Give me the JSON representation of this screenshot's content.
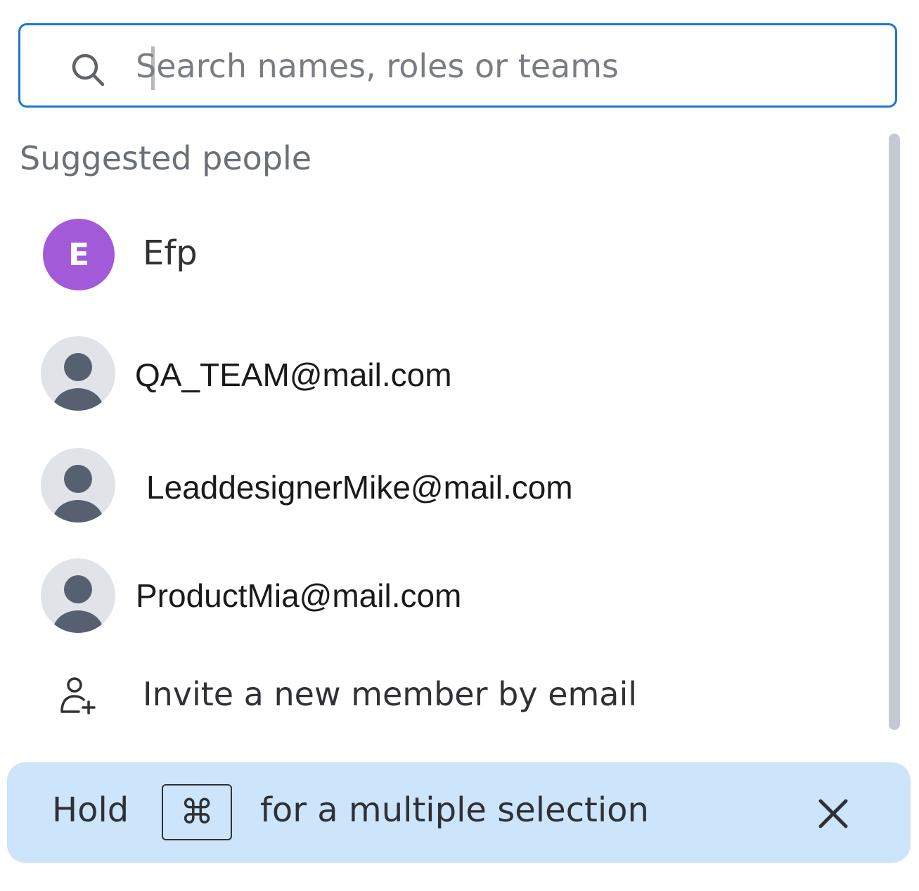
{
  "search": {
    "placeholder": "Search names, roles or teams",
    "value": "",
    "icon": "search-icon",
    "border_color": "#1f76d2"
  },
  "section": {
    "title": "Suggested people"
  },
  "people": [
    {
      "initial": "E",
      "name": "Efp",
      "avatar": "letter",
      "avatar_color": "#a25ad9"
    },
    {
      "name": "QA_TEAM@mail.com",
      "avatar": "generic-person-icon"
    },
    {
      "name": "LeaddesignerMike@mail.com",
      "avatar": "generic-person-icon"
    },
    {
      "name": "ProductMia@mail.com",
      "avatar": "generic-person-icon"
    }
  ],
  "invite": {
    "label": "Invite a new member by email",
    "icon": "add-person-icon"
  },
  "tip": {
    "hold": "Hold",
    "key": "⌘",
    "rest": "for a multiple selection",
    "close_icon": "close-icon",
    "background": "#cce5fb"
  }
}
